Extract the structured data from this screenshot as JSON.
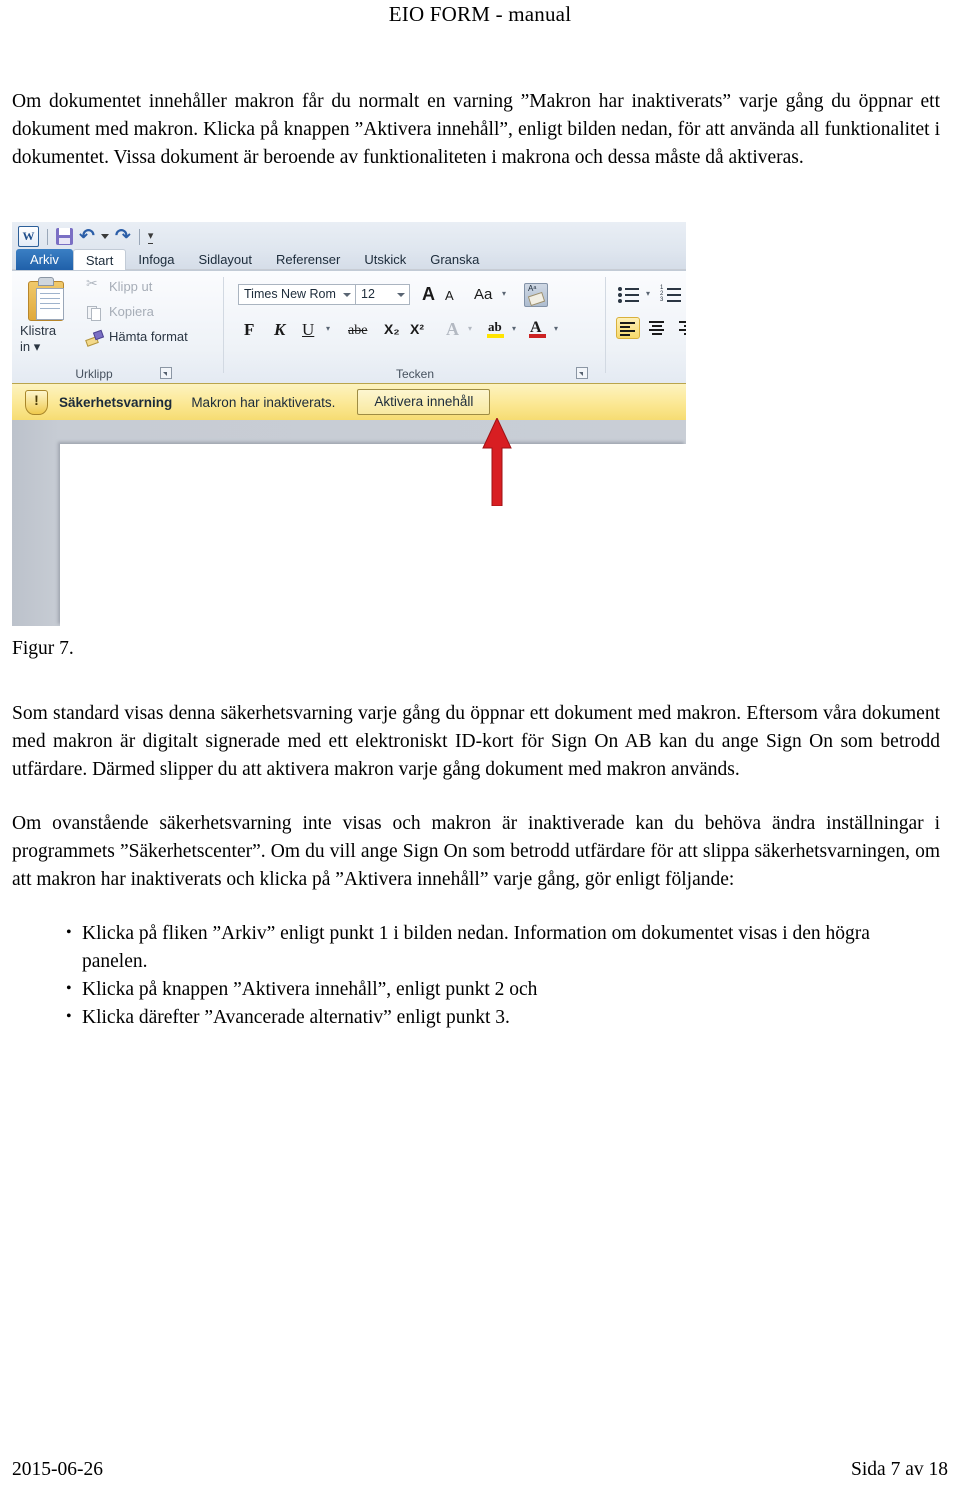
{
  "header": {
    "title": "EIO FORM - manual"
  },
  "intro": {
    "paragraph": "Om dokumentet innehåller makron får du normalt en varning ”Makron har inaktiverats” varje gång du öppnar ett dokument med makron. Klicka på knappen ”Aktivera innehåll”, enligt bilden nedan, för att använda all funktionalitet i dokumentet. Vissa dokument är beroende av funktionaliteten i makrona och dessa måste då aktiveras."
  },
  "figure": {
    "caption": "Figur 7.",
    "quick_access": {
      "app_orb": "W",
      "save": "save-icon",
      "undo": "undo-icon",
      "undo_dropdown": "caret-down-icon",
      "redo": "redo-icon",
      "customize": "customize-qat-icon"
    },
    "tabs": [
      {
        "label": "Arkiv",
        "state": "file"
      },
      {
        "label": "Start",
        "state": "active"
      },
      {
        "label": "Infoga",
        "state": "normal"
      },
      {
        "label": "Sidlayout",
        "state": "normal"
      },
      {
        "label": "Referenser",
        "state": "normal"
      },
      {
        "label": "Utskick",
        "state": "normal"
      },
      {
        "label": "Granska",
        "state": "normal"
      }
    ],
    "groups": {
      "clipboard": {
        "label": "Urklipp",
        "paste_label_line1": "Klistra",
        "paste_label_line2": "in",
        "items": [
          {
            "label": "Klipp ut",
            "icon": "scissors-icon",
            "enabled": false
          },
          {
            "label": "Kopiera",
            "icon": "copy-icon",
            "enabled": false
          },
          {
            "label": "Hämta format",
            "icon": "format-painter-icon",
            "enabled": true
          }
        ]
      },
      "font": {
        "label": "Tecken",
        "font_name": "Times New Rom",
        "font_size": "12",
        "grow_font": "A",
        "shrink_font": "A",
        "change_case": "Aa",
        "clear_formatting": "clear-formatting-icon",
        "bold": "F",
        "italic": "K",
        "underline": "U",
        "strikethrough": "abe",
        "subscript": "X₂",
        "superscript": "X²",
        "text_effects": "A",
        "highlight": "ab",
        "font_color": "A"
      },
      "paragraph": {
        "bullets": "bullet-list-icon",
        "numbering": "numbered-list-icon",
        "align_left": "align-left-icon",
        "align_center": "align-center-icon",
        "align_right": "align-right-icon"
      }
    },
    "security_bar": {
      "shield": "warning-shield-icon",
      "title": "Säkerhetsvarning",
      "message": "Makron har inaktiverats.",
      "button": "Aktivera innehåll"
    },
    "callout": {
      "arrow": "red-up-arrow",
      "color": "#d81e22"
    }
  },
  "sections": {
    "para_default": "Som standard visas denna säkerhetsvarning varje gång du öppnar ett dokument med makron. Eftersom våra dokument med makron är digitalt signerade med ett elektroniskt ID-kort för Sign On AB kan du ange Sign On som betrodd utfärdare. Därmed slipper du att aktivera makron varje gång dokument med makron används.",
    "para_settings": "Om ovanstående säkerhetsvarning inte visas och makron är inaktiverade kan du behöva ändra inställningar i programmets ”Säkerhetscenter”. Om du vill ange Sign On som betrodd utfärdare för att slippa säkerhetsvarningen, om att makron har inaktiverats och klicka på ”Aktivera innehåll” varje gång, gör enligt följande:",
    "bullets": [
      "Klicka på fliken ”Arkiv” enligt punkt 1 i bilden nedan. Information om dokumentet visas i den högra panelen.",
      "Klicka på knappen ”Aktivera innehåll”, enligt punkt 2 och",
      "Klicka därefter ”Avancerade alternativ” enligt punkt 3."
    ]
  },
  "footer": {
    "date": "2015-06-26",
    "page": "Sida 7 av 18"
  }
}
